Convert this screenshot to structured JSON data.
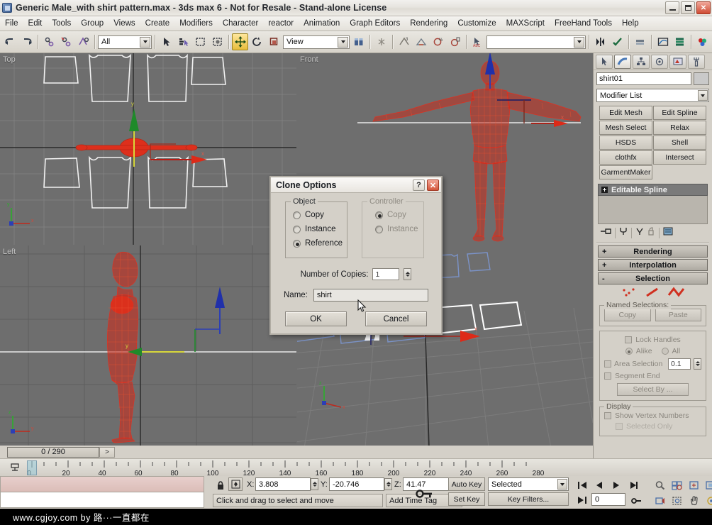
{
  "window": {
    "title": "Generic Male_with shirt pattern.max - 3ds max 6 - Not for Resale - Stand-alone License",
    "minimize": "–",
    "restore": "❐",
    "close": "✕"
  },
  "menu": {
    "items": [
      "File",
      "Edit",
      "Tools",
      "Group",
      "Views",
      "Create",
      "Modifiers",
      "Character",
      "reactor",
      "Animation",
      "Graph Editors",
      "Rendering",
      "Customize",
      "MAXScript",
      "FreeHand Tools",
      "Help"
    ]
  },
  "toolbar": {
    "selection_filter": "All",
    "reference_coord_system": "View",
    "named_selection_sets": "",
    "named_selection_placeholder": "",
    "buttons": [
      "undo-button",
      "redo-button",
      "select-and-link-button",
      "unlink-selection-button",
      "bind-to-space-warp-button",
      "select-object-button",
      "select-by-name-button",
      "rectangular-selection-region-button",
      "window-crossing-button",
      "select-and-move-button",
      "select-and-rotate-button",
      "select-and-scale-button",
      "use-pivot-point-center-button",
      "select-and-manipulate-button",
      "snap-toggle-button",
      "angle-snap-toggle-button",
      "percent-snap-toggle-button",
      "spinner-snap-toggle-button",
      "named-selection-sets-button",
      "mirror-button",
      "align-button",
      "layer-manager-button",
      "curve-editor-button",
      "schematic-view-button",
      "material-editor-button",
      "render-scene-dialog-button"
    ]
  },
  "viewports": [
    {
      "id": "top",
      "label": "Top",
      "active": true,
      "bg": "#6e6e6e"
    },
    {
      "id": "front",
      "label": "Front",
      "active": false,
      "bg": "#6e6e6e"
    },
    {
      "id": "left",
      "label": "Left",
      "active": false,
      "bg": "#6e6e6e"
    },
    {
      "id": "persp",
      "label": "",
      "active": false,
      "bg": "#6e6e6e"
    }
  ],
  "command_panel": {
    "tabs": [
      "create-tab",
      "modify-tab",
      "hierarchy-tab",
      "motion-tab",
      "display-tab",
      "utilities-tab"
    ],
    "selected_tab_index": 1,
    "object_name": "shirt01",
    "modifier_list_label": "Modifier List",
    "modifier_buttons": [
      "Edit Mesh",
      "Edit Spline",
      "Mesh Select",
      "Relax",
      "HSDS",
      "Shell",
      "clothfx",
      "Intersect",
      "GarmentMaker"
    ],
    "stack_entry": "Editable Spline",
    "rollouts": [
      {
        "label": "Rendering",
        "state": "+"
      },
      {
        "label": "Interpolation",
        "state": "+"
      },
      {
        "label": "Selection",
        "state": "-"
      }
    ],
    "selection": {
      "named_selections_title": "Named Selections:",
      "copy_label": "Copy",
      "paste_label": "Paste",
      "lock_handles_label": "Lock Handles",
      "alike_label": "Alike",
      "all_label": "All",
      "area_selection_label": "Area Selection",
      "area_selection_value": "0.1",
      "segment_end_label": "Segment End",
      "select_by_label": "Select By ...",
      "display_title": "Display",
      "show_vertex_numbers_label": "Show Vertex Numbers",
      "selected_only_label": "Selected Only"
    }
  },
  "dialog": {
    "title": "Clone Options",
    "help_label": "?",
    "close_label": "✕",
    "object_group": {
      "title": "Object",
      "options": [
        "Copy",
        "Instance",
        "Reference"
      ],
      "selected": "Reference"
    },
    "controller_group": {
      "title": "Controller",
      "options": [
        "Copy",
        "Instance"
      ],
      "selected": "Copy",
      "disabled": true
    },
    "number_of_copies_label": "Number of Copies:",
    "number_of_copies_value": "1",
    "name_label": "Name:",
    "name_value": "shirt",
    "ok_label": "OK",
    "cancel_label": "Cancel"
  },
  "timeline": {
    "frame_counter": "0 / 290",
    "next_frame_label": ">",
    "current_frame_tick": "0",
    "ticks": [
      "0",
      "20",
      "40",
      "60",
      "80",
      "100",
      "120",
      "140",
      "160",
      "180",
      "200",
      "220",
      "240",
      "260",
      "280"
    ]
  },
  "status_bar": {
    "lock_icon": "lock-selection-icon",
    "absolute_mode_icon": "absolute-relative-transform-toggle",
    "x_label": "X:",
    "x_value": "3.808",
    "y_label": "Y:",
    "y_value": "-20.746",
    "z_label": "Z:",
    "z_value": "41.47",
    "prompt": "Click and drag to select and move",
    "add_time_tag": "Add Time Tag",
    "key_mode_icon": "key-mode-toggle-icon",
    "auto_key": "Auto Key",
    "set_key": "Set Key",
    "key_filter_selected": "Selected",
    "key_filters": "Key Filters...",
    "current_frame_field": "0"
  },
  "nav_controls": {
    "buttons": [
      "zoom-icon",
      "zoom-all-icon",
      "zoom-extents-icon",
      "zoom-extents-all-icon",
      "field-of-view-icon",
      "pan-icon",
      "arc-rotate-icon",
      "min-max-toggle-icon"
    ]
  },
  "watermark": {
    "text": "www.cgjoy.com  by  路···一直都在"
  },
  "colors": {
    "viewport_bg": "#6e6e6e",
    "active_viewport_border": "#d4d430",
    "panel_bg": "#d4d0c8",
    "mesh_red": "#e0321e",
    "pattern_white": "#f0f0f0",
    "accent_yellow": "#e8bd3c",
    "axis_x": "#cc2222",
    "axis_y": "#22aa22",
    "axis_z": "#2222cc"
  }
}
